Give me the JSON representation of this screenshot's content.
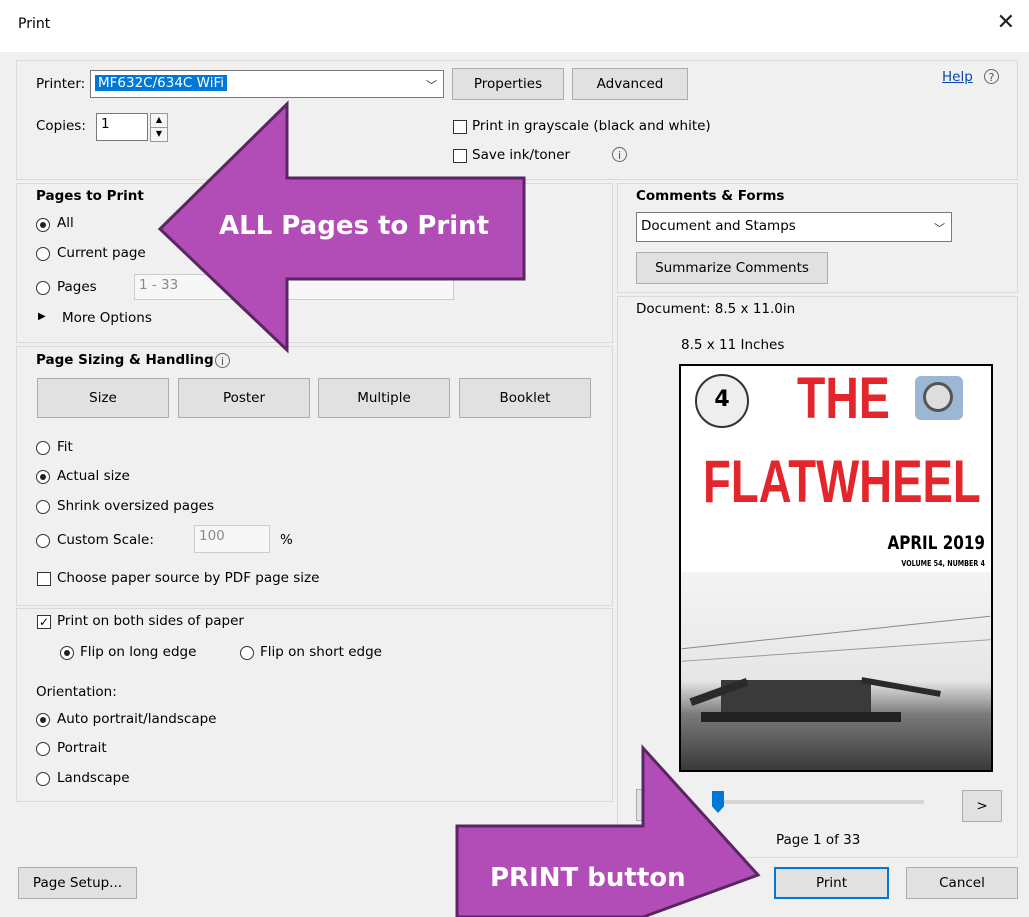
{
  "window": {
    "title": "Print",
    "close": "✕"
  },
  "printer": {
    "label": "Printer:",
    "value": "MF632C/634C WiFi",
    "properties": "Properties",
    "advanced": "Advanced",
    "help": "Help",
    "copies_label": "Copies:",
    "copies_value": "1",
    "grayscale": "Print in grayscale (black and white)",
    "save_ink": "Save ink/toner"
  },
  "pages_to_print": {
    "title": "Pages to Print",
    "all": "All",
    "current": "Current page",
    "pages": "Pages",
    "pages_value": "1 - 33",
    "more": "More Options"
  },
  "sizing": {
    "title": "Page Sizing & Handling",
    "tabs": [
      "Size",
      "Poster",
      "Multiple",
      "Booklet"
    ],
    "fit": "Fit",
    "actual": "Actual size",
    "shrink": "Shrink oversized pages",
    "custom": "Custom Scale:",
    "custom_value": "100",
    "percent": "%",
    "paper_source": "Choose paper source by PDF page size"
  },
  "duplex": {
    "both_sides": "Print on both sides of paper",
    "long_edge": "Flip on long edge",
    "short_edge": "Flip on short edge",
    "orientation": "Orientation:",
    "auto": "Auto portrait/landscape",
    "portrait": "Portrait",
    "landscape": "Landscape"
  },
  "comments": {
    "title": "Comments & Forms",
    "value": "Document and Stamps",
    "summarize": "Summarize Comments"
  },
  "preview": {
    "document": "Document: 8.5 x 11.0in",
    "size": "8.5 x 11 Inches",
    "cover_title_1": "THE",
    "cover_title_2": "FLATWHEEL",
    "cover_date": "APRIL 2019",
    "cover_volume": "VOLUME 54, NUMBER 4",
    "logo_left_text": "4",
    "page_info": "Page 1 of 33",
    "next": ">"
  },
  "footer": {
    "page_setup": "Page Setup...",
    "print": "Print",
    "cancel": "Cancel"
  },
  "annotations": {
    "all_pages": "ALL Pages to Print",
    "print_button": "PRINT button",
    "color": "#b24db8"
  }
}
